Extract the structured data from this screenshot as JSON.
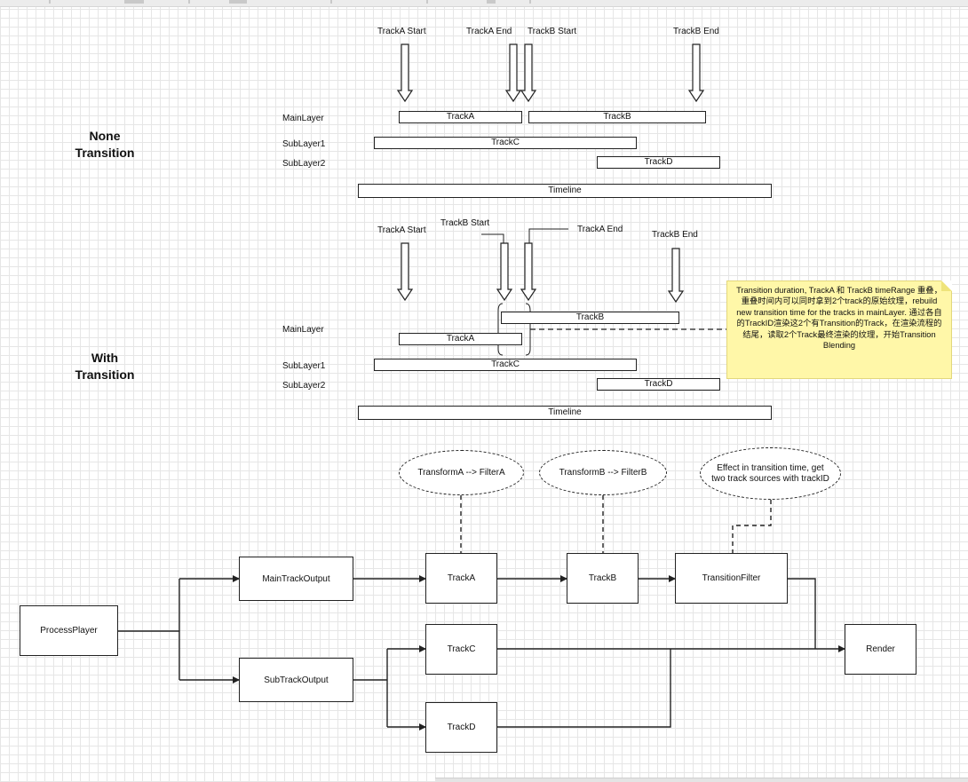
{
  "none_transition": {
    "title": "None\nTransition",
    "markers": [
      "TrackA Start",
      "TrackA End",
      "TrackB Start",
      "TrackB End"
    ],
    "layers": [
      "MainLayer",
      "SubLayer1",
      "SubLayer2"
    ],
    "tracks": [
      "TrackA",
      "TrackB",
      "TrackC",
      "TrackD"
    ],
    "timeline": "Timeline"
  },
  "with_transition": {
    "title": "With\nTransition",
    "markers": [
      "TrackA Start",
      "TrackB Start",
      "TrackA End",
      "TrackB End"
    ],
    "layers": [
      "MainLayer",
      "SubLayer1",
      "SubLayer2"
    ],
    "tracks": [
      "TrackB",
      "TrackA",
      "TrackC",
      "TrackD"
    ],
    "timeline": "Timeline",
    "note": "Transition duration, TrackA 和 TrackB timeRange 重叠，重叠时间内可以同时拿到2个track的原始纹理，rebuild new transition time for the tracks in mainLayer. 通过各自的TrackID渲染这2个有Transition的Track，在渲染流程的结尾，读取2个Track最终渲染的纹理，开始Transition Blending"
  },
  "pipeline": {
    "nodes": {
      "process_player": "ProcessPlayer",
      "main_track_output": "MainTrackOutput",
      "sub_track_output": "SubTrackOutput",
      "track_a": "TrackA",
      "track_b": "TrackB",
      "transition_filter": "TransitionFilter",
      "track_c": "TrackC",
      "track_d": "TrackD",
      "render": "Render"
    },
    "effects": {
      "transform_a": "TransformA --> FilterA",
      "transform_b": "TransformB --> FilterB",
      "effect_transition": "Effect in transition time, get two track sources with trackID"
    }
  },
  "colors": {
    "line": "#222222",
    "note_bg": "#fff7a8",
    "grid": "#e6e6e6"
  }
}
